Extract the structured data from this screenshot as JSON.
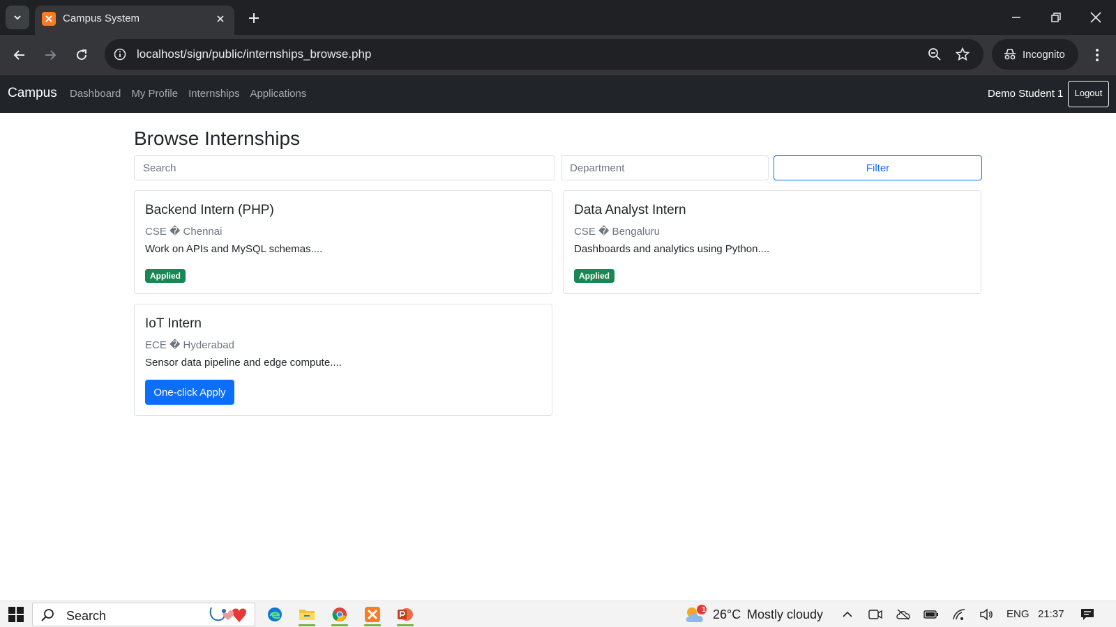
{
  "browser": {
    "tab_title": "Campus System",
    "url": "localhost/sign/public/internships_browse.php",
    "incognito_label": "Incognito"
  },
  "navbar": {
    "brand": "Campus",
    "links": [
      "Dashboard",
      "My Profile",
      "Internships",
      "Applications"
    ],
    "user_name": "Demo Student 1",
    "logout_label": "Logout"
  },
  "main": {
    "title": "Browse Internships",
    "search_placeholder": "Search",
    "department_placeholder": "Department",
    "filter_label": "Filter",
    "cards": [
      {
        "title": "Backend Intern (PHP)",
        "meta": "CSE � Chennai",
        "desc": "Work on APIs and MySQL schemas....",
        "status": "Applied"
      },
      {
        "title": "Data Analyst Intern",
        "meta": "CSE � Bengaluru",
        "desc": "Dashboards and analytics using Python....",
        "status": "Applied"
      },
      {
        "title": "IoT Intern",
        "meta": "ECE � Hyderabad",
        "desc": "Sensor data pipeline and edge compute....",
        "action": "One-click Apply"
      }
    ]
  },
  "taskbar": {
    "search_text": "Search",
    "weather_temp": "26°C",
    "weather_desc": "Mostly cloudy",
    "weather_badge": "1",
    "language": "ENG",
    "time": "21:37"
  },
  "colors": {
    "navbar_bg": "#212529",
    "primary": "#0d6efd",
    "success": "#198754",
    "chrome_dark": "#202124"
  }
}
